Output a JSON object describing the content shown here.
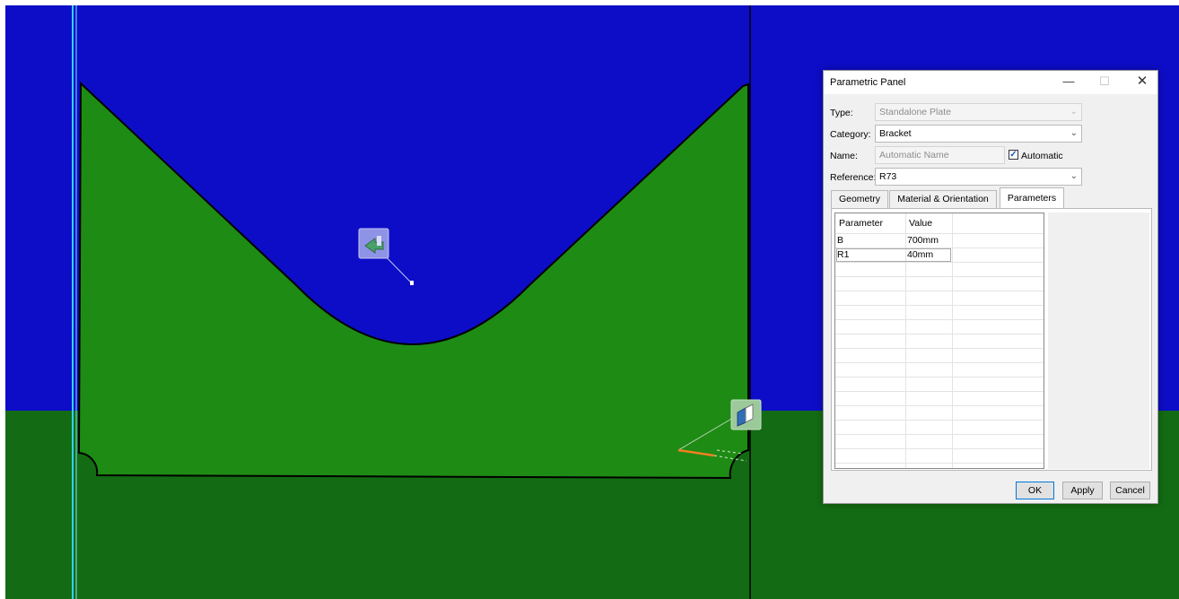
{
  "panel": {
    "title": "Parametric Panel",
    "window_controls": {
      "minimize": "—",
      "maximize": "☐",
      "close": "✕"
    },
    "type_label": "Type:",
    "type_value": "Standalone Plate",
    "category_label": "Category:",
    "category_value": "Bracket",
    "name_label": "Name:",
    "name_placeholder": "Automatic Name",
    "automatic_label": "Automatic",
    "automatic_checked": true,
    "reference_label": "Reference:",
    "reference_value": "R73",
    "tabs": [
      "Geometry",
      "Material & Orientation",
      "Parameters"
    ],
    "active_tab": "Parameters",
    "table": {
      "headers": [
        "Parameter",
        "Value"
      ],
      "rows": [
        {
          "parameter": "B",
          "value": "700mm"
        },
        {
          "parameter": "R1",
          "value": "40mm"
        }
      ]
    },
    "buttons": {
      "ok": "OK",
      "apply": "Apply",
      "cancel": "Cancel"
    },
    "dropdown_icon": "chevron-down-icon"
  },
  "viewport": {
    "colors": {
      "sky": "#0d0dc8",
      "ground": "#136c13",
      "plate": "#1e8b14",
      "edge": "#000000",
      "axis_line": "#33d1ff"
    },
    "icons": [
      "plate-gizmo-icon",
      "view-cube-icon"
    ]
  }
}
